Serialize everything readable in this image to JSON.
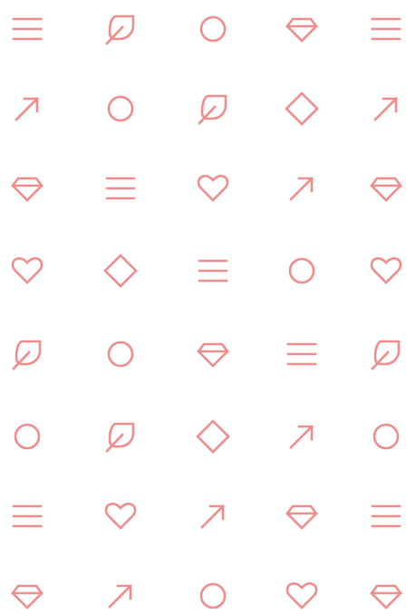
{
  "icon_color": "#ef8c8c",
  "background_color": "#ffffff",
  "rows": [
    [
      "menu-icon",
      "leaf-icon",
      "circle-icon",
      "diamond-gem-icon",
      "menu-icon"
    ],
    [
      "arrow-up-right-icon",
      "circle-icon",
      "leaf-icon",
      "rhombus-icon",
      "arrow-up-right-icon"
    ],
    [
      "diamond-gem-icon",
      "menu-icon",
      "heart-icon",
      "arrow-up-right-icon",
      "diamond-gem-icon"
    ],
    [
      "heart-icon",
      "rhombus-icon",
      "menu-icon",
      "circle-icon",
      "heart-icon"
    ],
    [
      "leaf-icon",
      "circle-icon",
      "diamond-gem-icon",
      "menu-icon",
      "leaf-icon"
    ],
    [
      "circle-icon",
      "leaf-icon",
      "rhombus-icon",
      "arrow-up-right-icon",
      "circle-icon"
    ],
    [
      "menu-icon",
      "heart-icon",
      "arrow-up-right-icon",
      "diamond-gem-icon",
      "menu-icon"
    ],
    [
      "diamond-gem-icon",
      "arrow-up-right-icon",
      "circle-icon",
      "heart-icon",
      "diamond-gem-icon"
    ]
  ]
}
